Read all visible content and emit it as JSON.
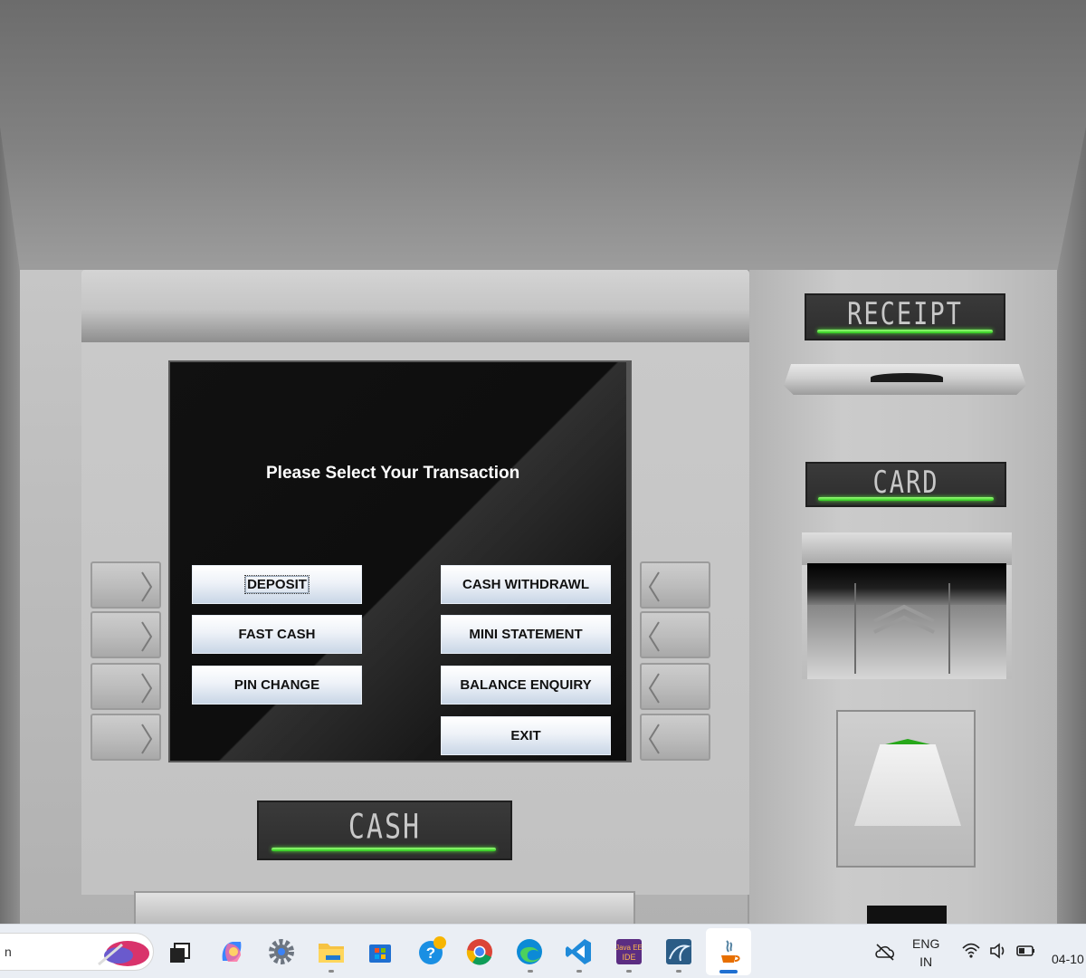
{
  "screen": {
    "title": "Please Select Your Transaction",
    "buttons": {
      "deposit": "DEPOSIT",
      "fast_cash": "FAST CASH",
      "pin_change": "PIN CHANGE",
      "cash_withdrawl": "CASH WITHDRAWL",
      "mini_statement": "MINI STATEMENT",
      "balance_enquiry": "BALANCE ENQUIRY",
      "exit": "EXIT"
    }
  },
  "atm_labels": {
    "receipt": "RECEIPT",
    "card": "CARD",
    "cash": "CASH"
  },
  "colors": {
    "indicator_green": "#3fd62a",
    "screen_black": "#0b0b0b",
    "button_gradient_bottom": "#c9d6e6"
  },
  "taskbar": {
    "search_text": "n",
    "apps": [
      {
        "icon": "task-view-icon"
      },
      {
        "icon": "copilot-icon"
      },
      {
        "icon": "settings-gear-icon"
      },
      {
        "icon": "file-explorer-icon"
      },
      {
        "icon": "microsoft-store-icon"
      },
      {
        "icon": "get-help-icon"
      },
      {
        "icon": "chrome-icon"
      },
      {
        "icon": "edge-icon"
      },
      {
        "icon": "vscode-icon"
      },
      {
        "icon": "java-ee-ide-icon"
      },
      {
        "icon": "mysql-workbench-icon"
      },
      {
        "icon": "java-icon"
      }
    ],
    "tray": {
      "lang_line1": "ENG",
      "lang_line2": "IN",
      "clock": "04-10"
    }
  }
}
